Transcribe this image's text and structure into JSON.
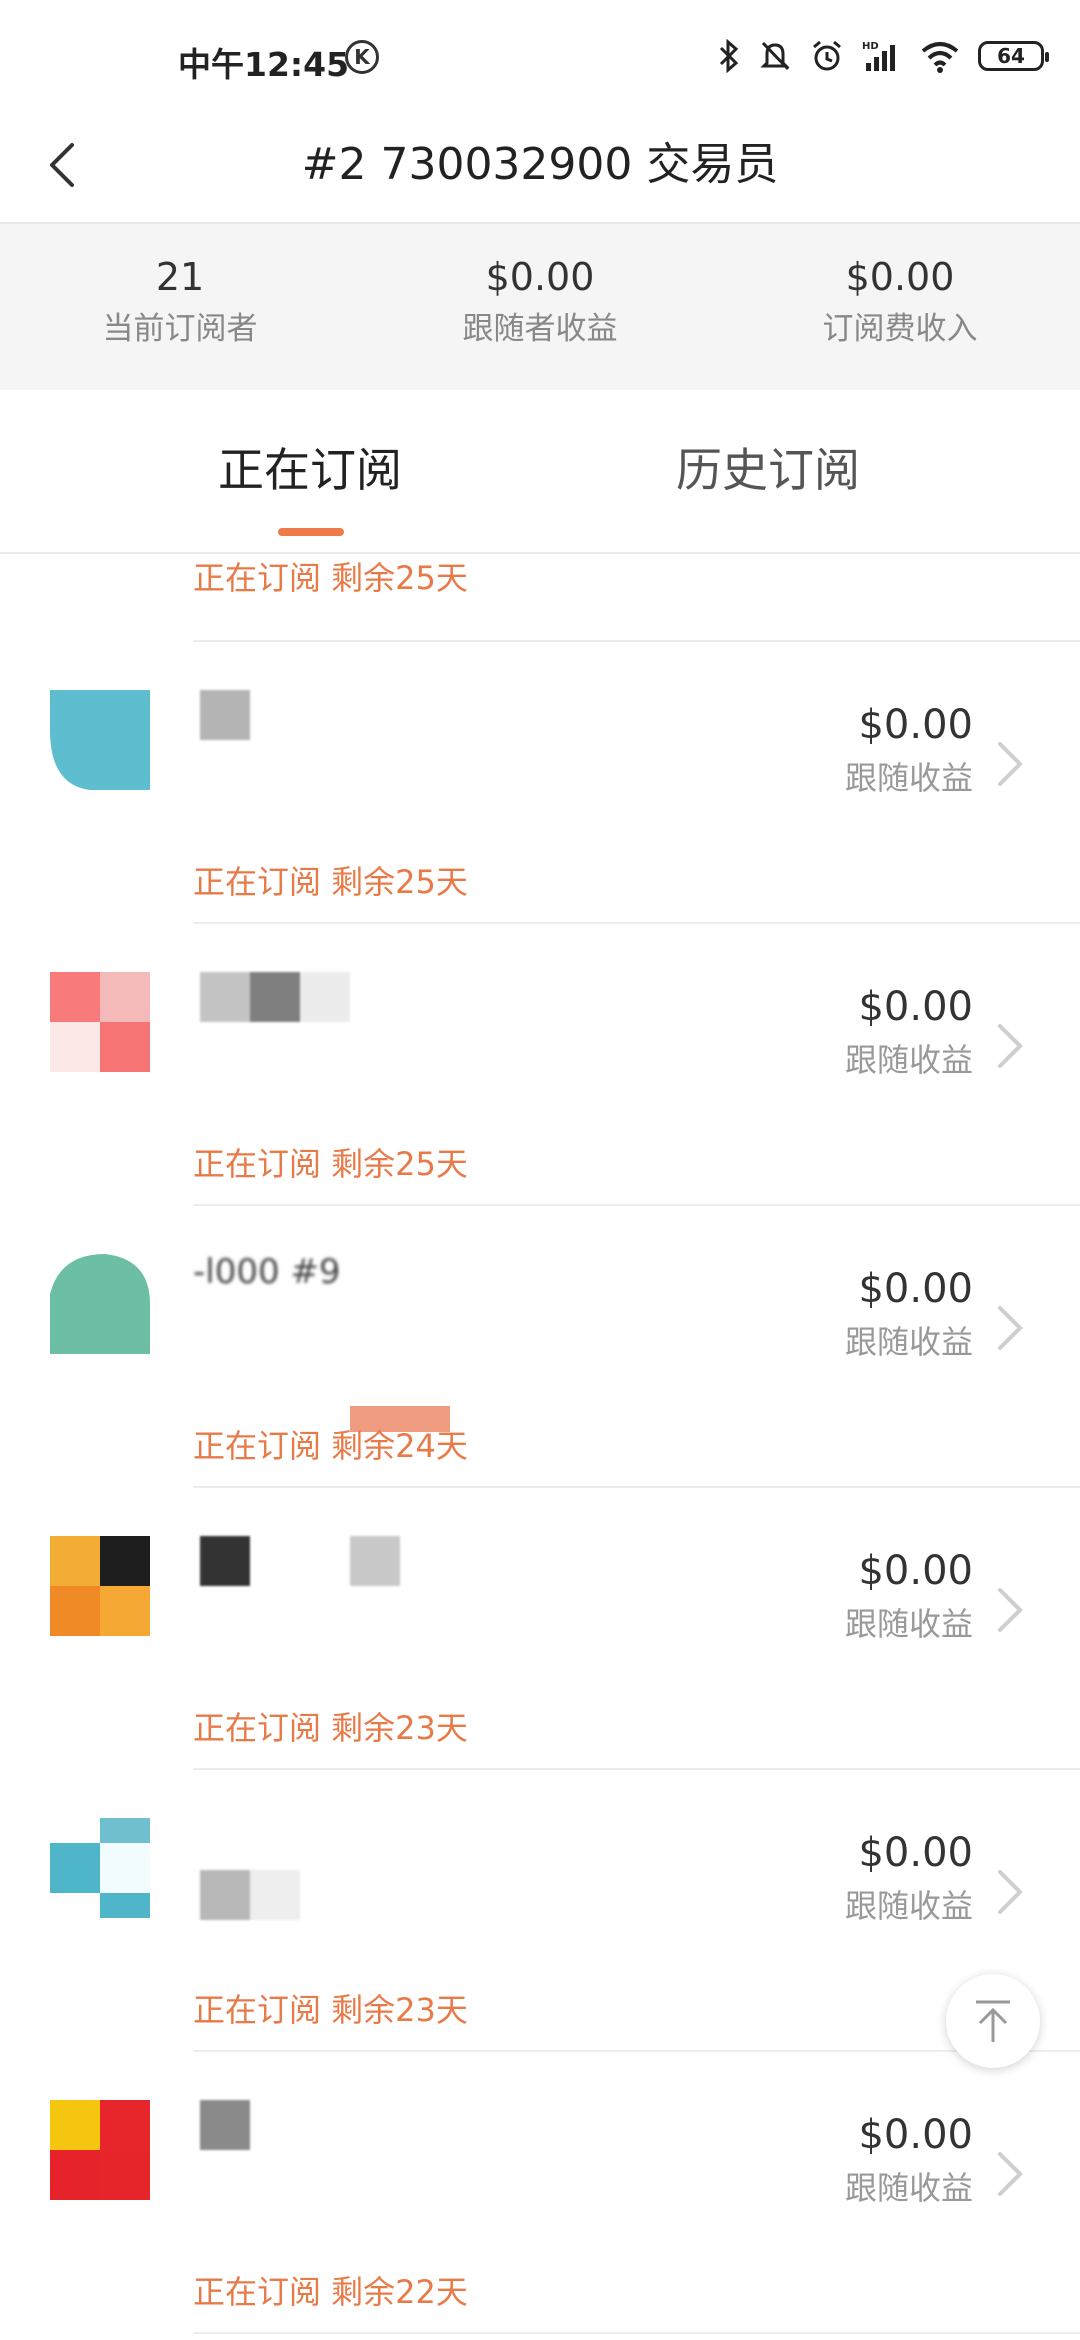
{
  "status_bar": {
    "time": "中午12:45",
    "k_badge": "K",
    "battery": "64",
    "icons": [
      "bluetooth-icon",
      "mute-icon",
      "alarm-icon",
      "signal-icon",
      "wifi-icon",
      "battery-icon"
    ]
  },
  "nav": {
    "title": "#2 730032900 交易员",
    "back_icon": "chevron-left-icon"
  },
  "stats": [
    {
      "value": "21",
      "label": "当前订阅者"
    },
    {
      "value": "$0.00",
      "label": "跟随者收益"
    },
    {
      "value": "$0.00",
      "label": "订阅费收入"
    }
  ],
  "tabs": [
    {
      "label": "正在订阅",
      "active": true
    },
    {
      "label": "历史订阅",
      "active": false
    }
  ],
  "list": {
    "partial_status": "正在订阅 剩余25天",
    "rows": [
      {
        "name": "",
        "amount": "$0.00",
        "amount_label": "跟随收益",
        "status": "正在订阅 剩余25天"
      },
      {
        "name": "",
        "amount": "$0.00",
        "amount_label": "跟随收益",
        "status": "正在订阅 剩余25天"
      },
      {
        "name": "-l000 #9",
        "amount": "$0.00",
        "amount_label": "跟随收益",
        "status": "正在订阅 剩余24天"
      },
      {
        "name": "",
        "amount": "$0.00",
        "amount_label": "跟随收益",
        "status": "正在订阅 剩余23天"
      },
      {
        "name": "",
        "amount": "$0.00",
        "amount_label": "跟随收益",
        "status": "正在订阅 剩余23天"
      },
      {
        "name": "",
        "amount": "$0.00",
        "amount_label": "跟随收益",
        "status": "正在订阅 剩余22天"
      }
    ]
  },
  "colors": {
    "accent": "#ef7a4a",
    "status_text": "#e87a48",
    "stats_bg": "#f5f5f5"
  }
}
